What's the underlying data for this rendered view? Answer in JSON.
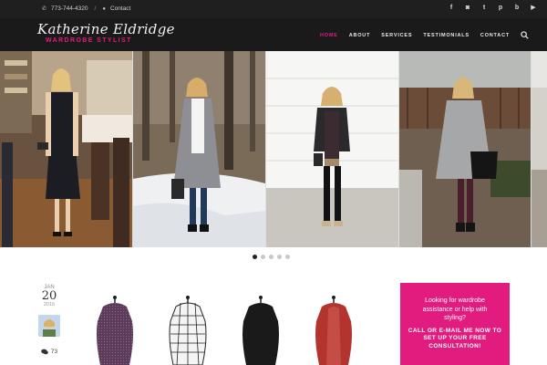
{
  "topbar": {
    "phone": "773-744-4320",
    "contact_label": "Contact",
    "social_icons": [
      "facebook-icon",
      "instagram-icon",
      "twitter-icon",
      "pinterest-icon",
      "bloglovin-icon",
      "youtube-icon"
    ]
  },
  "brand": {
    "name": "Katherine Eldridge",
    "tagline": "WARDROBE STYLIST",
    "accent_color": "#e21b7f"
  },
  "nav": {
    "items": [
      {
        "label": "HOME",
        "active": true
      },
      {
        "label": "ABOUT",
        "active": false
      },
      {
        "label": "SERVICES",
        "active": false
      },
      {
        "label": "TESTIMONIALS",
        "active": false
      },
      {
        "label": "CONTACT",
        "active": false
      }
    ]
  },
  "gallery": {
    "dots_count": 5,
    "active_dot": 1
  },
  "post": {
    "month": "JAN",
    "day": "20",
    "year": "2016",
    "comment_count": "73"
  },
  "cta": {
    "question": "Looking for wardrobe assistance or help with styling?",
    "call": "CALL OR E-MAIL ME NOW TO SET UP YOUR FREE CONSULTATION!"
  }
}
